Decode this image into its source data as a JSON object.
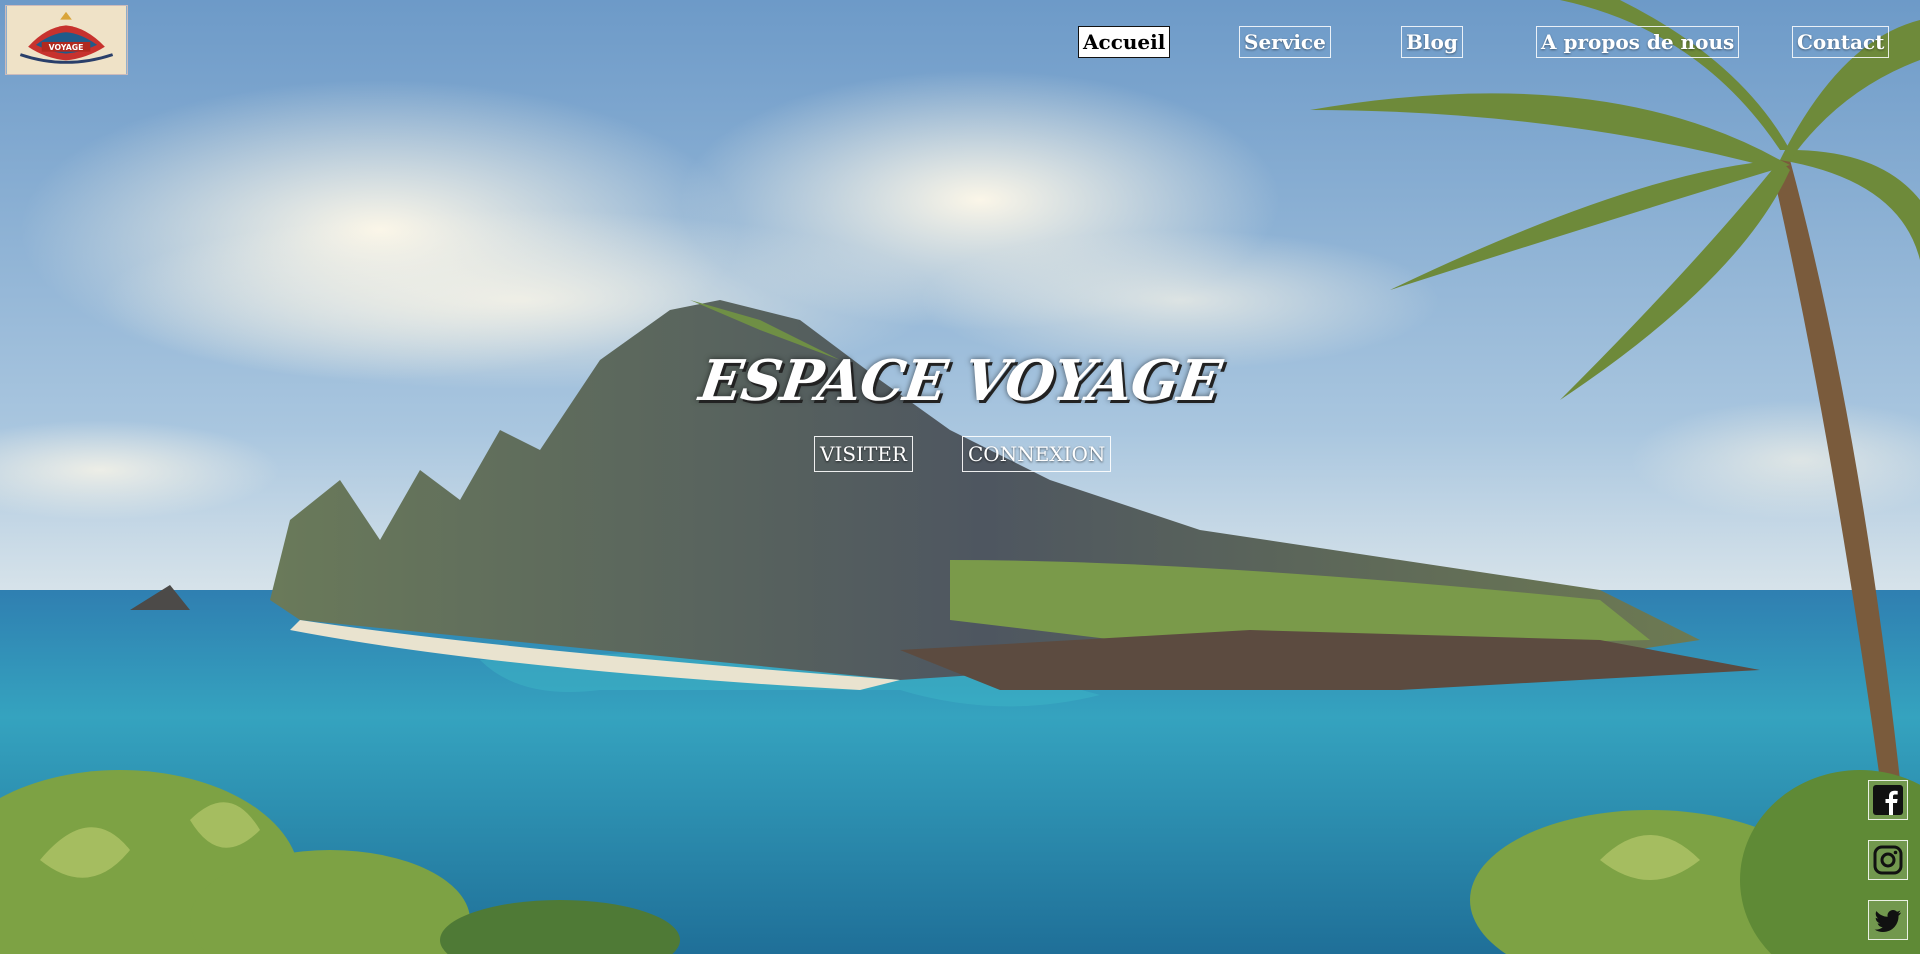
{
  "brand": {
    "logo_text": "VOYAGE"
  },
  "nav": {
    "items": [
      {
        "label": "Accueil",
        "active": true
      },
      {
        "label": "Service"
      },
      {
        "label": "Blog"
      },
      {
        "label": "A propos de nous"
      },
      {
        "label": "Contact"
      }
    ]
  },
  "hero": {
    "title": "ESPACE VOYAGE",
    "buttons": {
      "visit": "VISITER",
      "login": "CONNEXION"
    }
  },
  "social": [
    {
      "icon": "facebook-icon"
    },
    {
      "icon": "instagram-icon"
    },
    {
      "icon": "twitter-icon"
    }
  ],
  "colors": {
    "sky_top": "#6d9ac8",
    "sea": "#2a8fb3",
    "accent_text": "#ffffff"
  }
}
